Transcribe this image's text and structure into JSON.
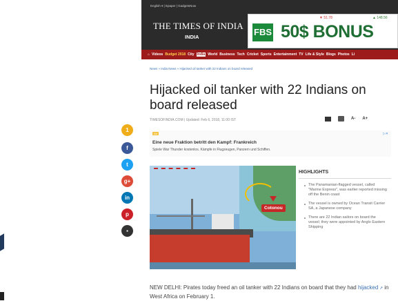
{
  "header": {
    "top_links": "English ▾  |  Epaper  |  GadgetsNow",
    "brand": "THE TIMES OF INDIA",
    "brand_sub": "INDIA",
    "ad": {
      "logo": "FBS",
      "text": "50$ BONUS",
      "ticker_left": "▼ 51.78",
      "ticker_right": "▲ 148.56"
    }
  },
  "nav": {
    "items": [
      "Videos",
      "Budget 2018",
      "City",
      "India",
      "World",
      "Business",
      "Tech",
      "Cricket",
      "Sports",
      "Entertainment",
      "TV",
      "Life & Style",
      "Blogs",
      "Photos",
      "Li"
    ],
    "highlight": "Budget 2018",
    "current": "India"
  },
  "article": {
    "breadcrumb": "News » India News » Hijacked oil tanker with 22 Indians on board released",
    "title": "Hijacked oil tanker with 22 Indians on board released",
    "meta": "TIMESOFINDIA.COM | Updated: Feb 6, 2018, 11:00 IST",
    "font_small": "A-",
    "font_large": "A+",
    "lede_prefix": "NEW DELHI: Pirates today freed an oil tanker with 22 Indians on board that they had",
    "lede_link": "hijacked",
    "lede_suffix": " in West Africa on February 1."
  },
  "share": {
    "comments_count": "1",
    "buttons": [
      {
        "name": "facebook",
        "glyph": "f",
        "color": "#3b5998"
      },
      {
        "name": "twitter",
        "glyph": "t",
        "color": "#1da1f2"
      },
      {
        "name": "google-plus",
        "glyph": "g+",
        "color": "#dd4b39"
      },
      {
        "name": "linkedin",
        "glyph": "in",
        "color": "#0077b5"
      },
      {
        "name": "pinterest",
        "glyph": "p",
        "color": "#cb2027"
      },
      {
        "name": "comment",
        "glyph": "▪",
        "color": "#333333"
      }
    ]
  },
  "sponsored": {
    "tag": "Ad",
    "close": "▷✕",
    "headline": "Eine neue Fraktion betritt den Kampf: Frankreich",
    "body": "Spiele War Thunder kostenlos. Kämpfe in Flugzeugen, Panzern und Schiffen."
  },
  "figure": {
    "location_label": "Cotonou"
  },
  "highlights": {
    "title": "HIGHLIGHTS",
    "items": [
      "The Panamanian-flagged vessel, called \"Marine Express\", was earlier reported missing off the Benin coast",
      "The vessel is owned by Ocean Transit Carrier SA, a Japanese company",
      "There are 22 Indian sailors on board the vessel; they were appointed by Anglo Eastern Shipping"
    ]
  }
}
